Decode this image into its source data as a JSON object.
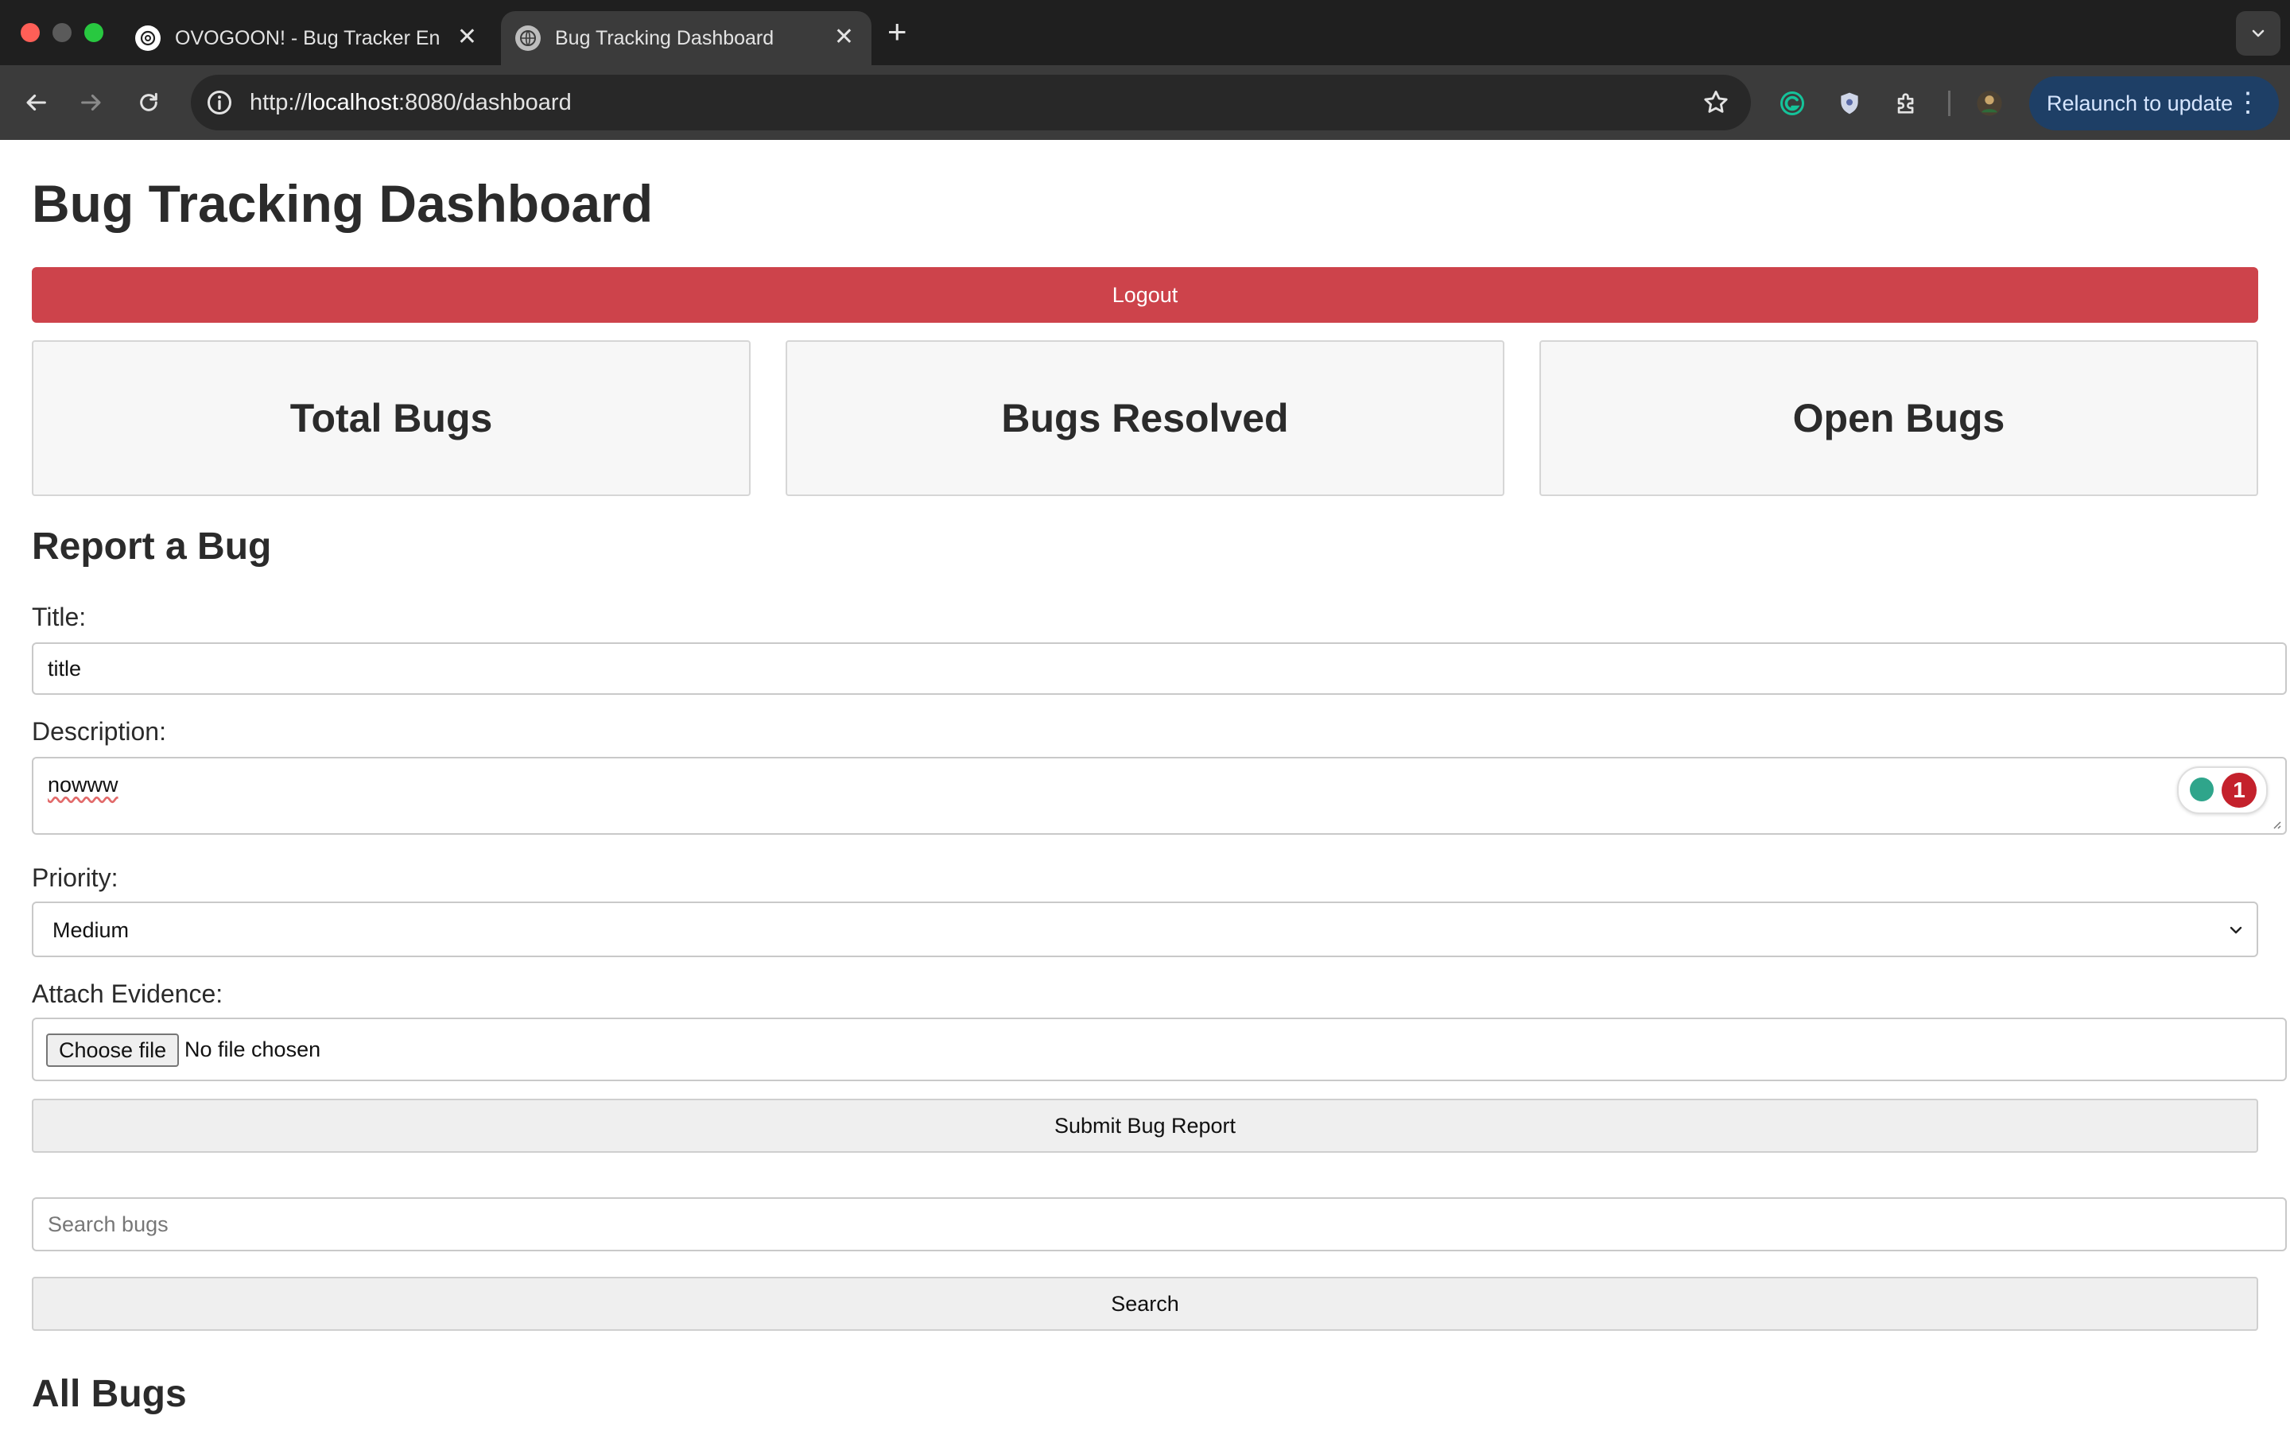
{
  "browser": {
    "tabs": [
      {
        "title": "OVOGOON! - Bug Tracker Enh",
        "active": false
      },
      {
        "title": "Bug Tracking Dashboard",
        "active": true
      }
    ],
    "new_tab_label": "+",
    "close_glyph": "✕",
    "url_prefix": "http://",
    "url_host": "localhost",
    "url_rest": ":8080/dashboard",
    "relaunch_label": "Relaunch to update",
    "menu_glyph": "⋮",
    "colors": {
      "tabstrip": "#1f1f1f",
      "toolbar": "#3b3b3b",
      "relaunch": "#1e3f66"
    }
  },
  "page": {
    "title": "Bug Tracking Dashboard",
    "logout_label": "Logout",
    "stats": {
      "total_label": "Total Bugs",
      "resolved_label": "Bugs Resolved",
      "open_label": "Open Bugs"
    },
    "report": {
      "heading": "Report a Bug",
      "title_label": "Title:",
      "title_value": "title",
      "description_label": "Description:",
      "description_value": "nowww",
      "grammarly_count": "1",
      "priority_label": "Priority:",
      "priority_value": "Medium",
      "evidence_label": "Attach Evidence:",
      "choose_file_label": "Choose file",
      "file_status": "No file chosen",
      "submit_label": "Submit Bug Report"
    },
    "search": {
      "placeholder": "Search bugs",
      "button_label": "Search"
    },
    "all_bugs_heading": "All Bugs",
    "colors": {
      "logout": "#cd434b"
    }
  }
}
